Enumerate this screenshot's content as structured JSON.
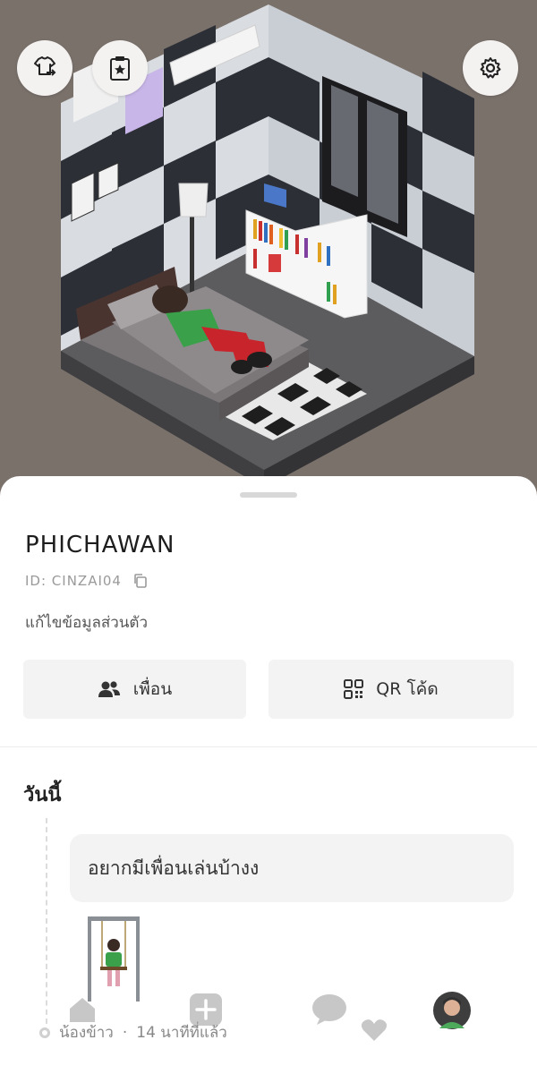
{
  "profile": {
    "name": "PHICHAWAN",
    "id_text": "ID: CINZAI04",
    "edit_label": "แก้ไขข้อมูลส่วนตัว"
  },
  "actions": {
    "friends_label": "เพื่อน",
    "qr_label": "QR โค้ด"
  },
  "feed": {
    "section_title": "วันนี้",
    "post_text": "อยากมีเพื่อนเล่นบ้างง",
    "post_author": "น้องข้าว",
    "post_time": "14 นาทีที่แล้ว",
    "separator": "·"
  },
  "top_buttons": {
    "outfit_icon": "shirt-swap-icon",
    "clipboard_icon": "clipboard-star-icon",
    "settings_icon": "gear-icon"
  },
  "nav": {
    "items": [
      "home-icon",
      "add-icon",
      "chat-icon",
      "heart-icon",
      "profile-avatar"
    ]
  },
  "colors": {
    "background": "#7a716b",
    "sheet": "#ffffff",
    "button_bg": "#f3f3f3",
    "avatar_shirt": "#3aa14a",
    "avatar_pants": "#c8242c"
  }
}
